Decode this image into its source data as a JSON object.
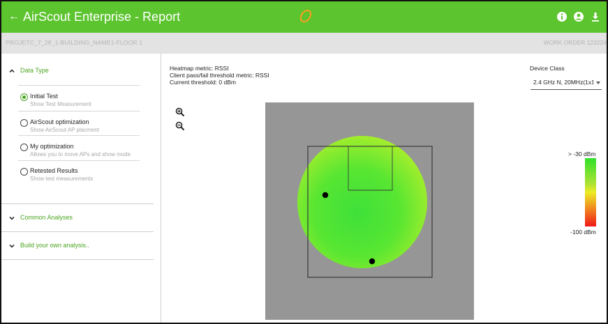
{
  "header": {
    "title": "AirScout Enterprise - Report",
    "back_icon": "arrow-left-icon",
    "logo_icon": "airscout-logo-icon",
    "actions": [
      "info-icon",
      "account-icon",
      "download-icon"
    ],
    "bar_color": "#5cc42e"
  },
  "subheader": {
    "project": "PROJETC_7_28_1-BUILDING_NAME1-FLOOR 1",
    "work_order": "WORK ORDER 123224"
  },
  "sidebar": {
    "data_type": {
      "label": "Data Type",
      "expanded": true,
      "options": [
        {
          "title": "Initial Test",
          "subtitle": "Show Test Measurement",
          "selected": true
        },
        {
          "title": "AirScout optimization",
          "subtitle": "Show AirScout AP placment",
          "selected": false
        },
        {
          "title": "My optimization",
          "subtitle": "Allows you to move APs and show mode",
          "selected": false
        },
        {
          "title": "Retested Results",
          "subtitle": "Show test measurements",
          "selected": false
        }
      ]
    },
    "common_analyses": {
      "label": "Common Analyses",
      "expanded": false
    },
    "build_analysis": {
      "label": "Build your own analysis..",
      "expanded": false
    }
  },
  "main": {
    "heatmap_metric": "Heatmap metric: RSSI",
    "client_threshold_metric": "Client pass/fail threshold metric: RSSI",
    "current_threshold": "Current threshold: 0 dBm",
    "device_class_label": "Device Class",
    "device_class_value": "2.4 GHz N, 20MHz(1x1)",
    "zoom_in_icon": "zoom-in-icon",
    "zoom_out_icon": "zoom-out-icon",
    "scale": {
      "top_label": "> -30 dBm",
      "bottom_label": "-100 dBm",
      "colors": [
        "#2fe12a",
        "#aee233",
        "#ecec25",
        "#f09020",
        "#f01818"
      ]
    },
    "heatmap": {
      "access_points": 2,
      "background_color": "#969696",
      "coverage_color": "#5ee82f"
    }
  }
}
